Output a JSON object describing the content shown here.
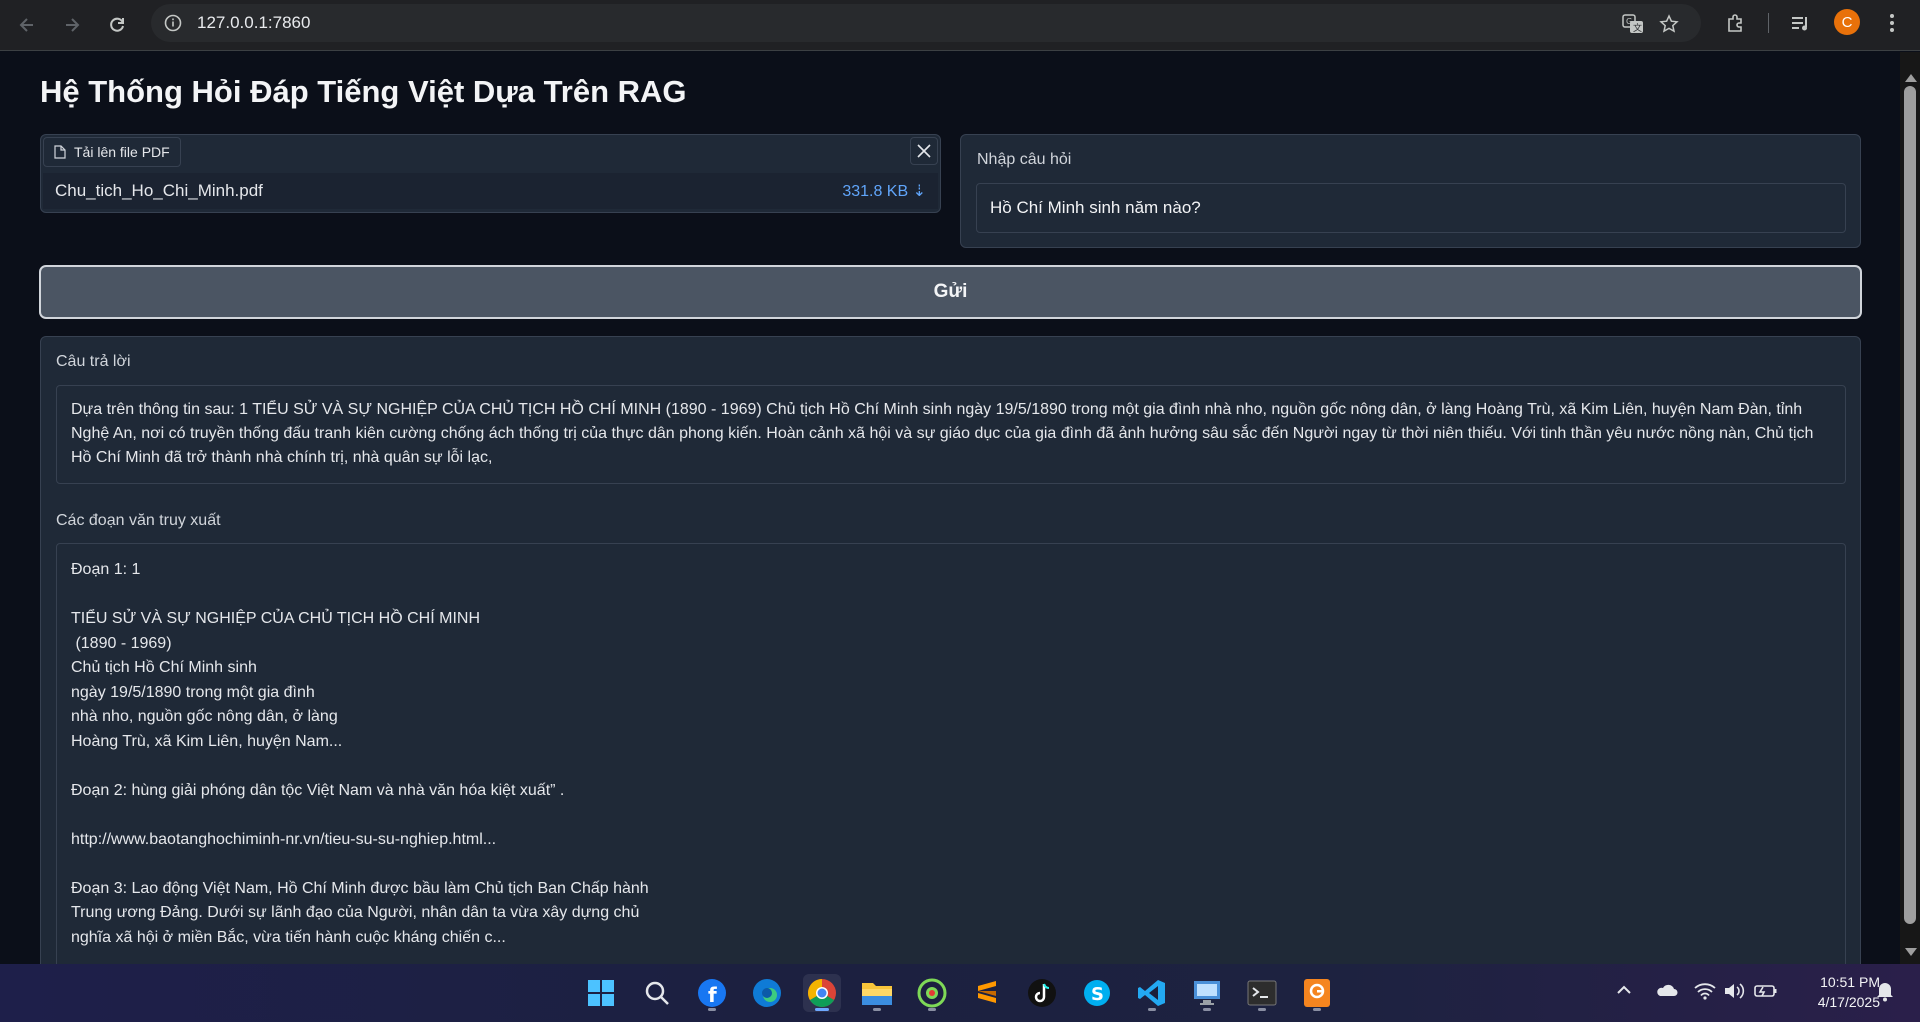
{
  "browser": {
    "url": "127.0.0.1:7860",
    "profile_initial": "C"
  },
  "app": {
    "title": "Hệ Thống Hỏi Đáp Tiếng Việt Dựa Trên RAG",
    "upload": {
      "label": "Tải lên file PDF",
      "file_name": "Chu_tich_Ho_Chi_Minh.pdf",
      "file_size": "331.8 KB ⇣"
    },
    "question": {
      "label": "Nhập câu hỏi",
      "value": "Hồ Chí Minh sinh năm nào?"
    },
    "send_label": "Gửi",
    "answer": {
      "label": "Câu trả lời",
      "text": "Dựa trên thông tin sau: 1 TIỂU SỬ VÀ SỰ NGHIỆP CỦA CHỦ TỊCH HỒ CHÍ MINH (1890 - 1969) Chủ tịch Hồ Chí Minh sinh ngày 19/5/1890 trong một gia đình nhà nho, nguồn gốc nông dân, ở làng Hoàng Trù, xã Kim Liên, huyện Nam Đàn, tỉnh Nghệ An, nơi có truyền thống đấu tranh kiên cường chống ách thống trị của thực dân phong kiến. Hoàn cảnh xã hội và sự giáo dục của gia đình đã ảnh hưởng sâu sắc đến Người ngay từ thời niên thiếu. Với tinh thần yêu nước nồng nàn, Chủ tịch Hồ Chí Minh đã trở thành nhà chính trị, nhà quân sự lỗi lạc,"
    },
    "passages": {
      "label": "Các đoạn văn truy xuất",
      "text": "Đoạn 1: 1\n\nTIỂU SỬ VÀ SỰ NGHIỆP CỦA CHỦ TỊCH HỒ CHÍ MINH\n (1890 - 1969)\nChủ tịch Hồ Chí Minh sinh\nngày 19/5/1890 trong một gia đình\nnhà nho, nguồn gốc nông dân, ở làng\nHoàng Trù, xã Kim Liên, huyện Nam...\n\nĐoạn 2: hùng giải phóng dân tộc Việt Nam và nhà văn hóa kiệt xuất” .\n\nhttp://www.baotanghochiminh-nr.vn/tieu-su-su-nghiep.html...\n\nĐoạn 3: Lao động Việt Nam, Hồ Chí Minh được bầu làm Chủ tịch Ban Chấp hành\nTrung ương Đảng. Dưới sự lãnh đạo của Người, nhân dân ta vừa xây dựng chủ\nnghĩa xã hội ở miền Bắc, vừa tiến hành cuộc kháng chiến c..."
    }
  },
  "taskbar": {
    "apps": [
      "start-icon",
      "search-icon",
      "facebook-icon",
      "edge-icon",
      "chrome-icon",
      "file-explorer-icon",
      "coccoc-icon",
      "sublime-icon",
      "tiktok-icon",
      "skype-icon",
      "vscode-icon",
      "remote-desktop-icon",
      "terminal-icon",
      "pdf-app-icon"
    ],
    "time": "10:51 PM",
    "date": "4/17/2025"
  },
  "colors": {
    "page_bg": "#0b0f19",
    "panel_bg": "#1f2937",
    "border": "#374151",
    "link_blue": "#60a5fa",
    "button_bg": "#4b5563"
  }
}
